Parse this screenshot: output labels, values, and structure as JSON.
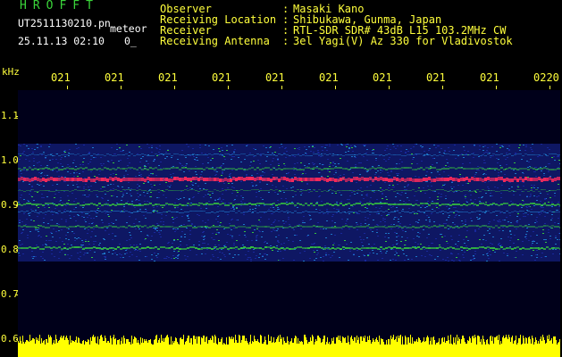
{
  "header": {
    "app_title": "HROFFT",
    "file_name": "UT2511130210.pn",
    "tag": "meteor",
    "datetime": "25.11.13 02:10",
    "counter": "0_"
  },
  "station_info": [
    {
      "label": "Observer",
      "value": "Masaki Kano"
    },
    {
      "label": "Receiving Location",
      "value": "Shibukawa, Gunma, Japan"
    },
    {
      "label": "Receiver",
      "value": "RTL-SDR SDR# 43dB L15 103.2MHz CW"
    },
    {
      "label": "Receiving Antenna",
      "value": "3el Yagi(V) Az 330 for Vladivostok"
    }
  ],
  "spectrogram": {
    "y_unit": "kHz",
    "y_ticks": [
      "1.1",
      "1.0",
      "0.9",
      "0.8",
      "0.7",
      "0.6"
    ],
    "x_ticks": [
      "021",
      "021",
      "021",
      "021",
      "021",
      "021",
      "021",
      "021",
      "021",
      "0220"
    ],
    "colors": {
      "background": "#00001a",
      "noise_low": "#1a2aa0",
      "noise_mid": "#1f7fd0",
      "band_green": "#3ad53a",
      "carrier": "#ff2a5a",
      "signal_bar": "#ffff00",
      "axis_text": "#ffff3c"
    }
  }
}
